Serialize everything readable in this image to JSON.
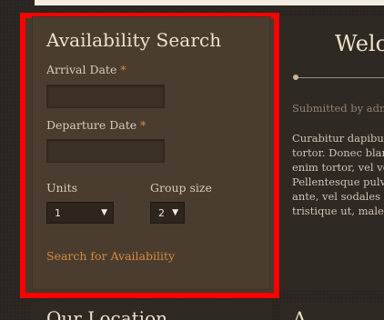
{
  "availability": {
    "title": "Availability Search",
    "arrival_label": "Arrival Date",
    "departure_label": "Departure Date",
    "required_mark": "*",
    "arrival_value": "",
    "departure_value": "",
    "units_label": "Units",
    "units_value": "1",
    "group_label": "Group size",
    "group_value": "2",
    "search_link": "Search for Availability"
  },
  "welcome": {
    "title": "Welco",
    "submitted": "Submitted by admi",
    "body_lines": [
      "Curabitur dapibus",
      "tortor. Donec blar",
      "enim tortor, vel ve",
      "Pellentesque pulv",
      "ante, vel sodales c",
      "tristique ut, males"
    ]
  },
  "bottom": {
    "left_title": "Our Location",
    "right_title": "A"
  },
  "colors": {
    "highlight": "#ff0000",
    "panel": "#4a3d30",
    "accent": "#d98a3b",
    "heading": "#f0e2c6"
  },
  "icons": {
    "select_arrow": "triangle-down"
  }
}
